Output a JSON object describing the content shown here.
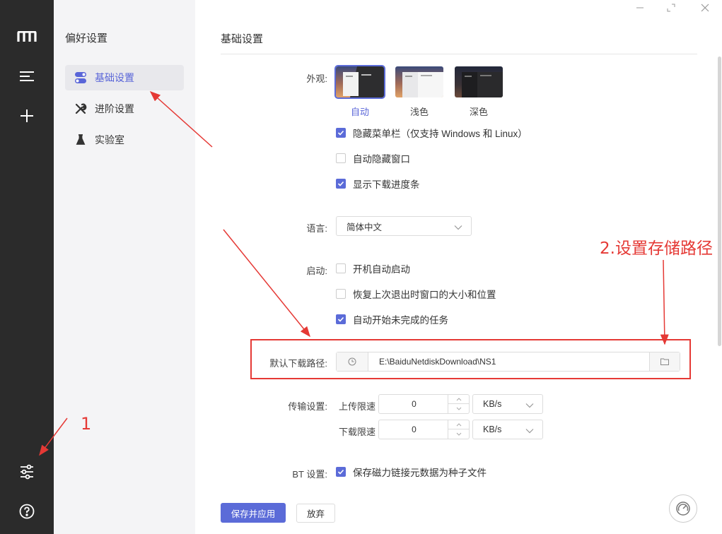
{
  "sidebar": {
    "title": "偏好设置",
    "items": [
      {
        "label": "基础设置"
      },
      {
        "label": "进阶设置"
      },
      {
        "label": "实验室"
      }
    ]
  },
  "main": {
    "title": "基础设置",
    "appearance": {
      "label": "外观:",
      "themes": [
        {
          "label": "自动",
          "selected": true
        },
        {
          "label": "浅色",
          "selected": false
        },
        {
          "label": "深色",
          "selected": false
        }
      ],
      "options": [
        {
          "label": "隐藏菜单栏（仅支持 Windows 和 Linux）",
          "checked": true
        },
        {
          "label": "自动隐藏窗口",
          "checked": false
        },
        {
          "label": "显示下载进度条",
          "checked": true
        }
      ]
    },
    "language": {
      "label": "语言:",
      "value": "简体中文"
    },
    "startup": {
      "label": "启动:",
      "options": [
        {
          "label": "开机自动启动",
          "checked": false
        },
        {
          "label": "恢复上次退出时窗口的大小和位置",
          "checked": false
        },
        {
          "label": "自动开始未完成的任务",
          "checked": true
        }
      ]
    },
    "download_path": {
      "label": "默认下载路径:",
      "value": "E:\\BaiduNetdiskDownload\\NS1"
    },
    "transfer": {
      "label": "传输设置:",
      "upload": {
        "label": "上传限速",
        "value": "0",
        "unit": "KB/s"
      },
      "download": {
        "label": "下载限速",
        "value": "0",
        "unit": "KB/s"
      }
    },
    "bt": {
      "label": "BT 设置:",
      "option": {
        "label": "保存磁力链接元数据为种子文件",
        "checked": true
      }
    },
    "buttons": {
      "save": "保存并应用",
      "discard": "放弃"
    }
  },
  "annotations": {
    "step1": "1",
    "step2": "2.设置存储路径"
  },
  "colors": {
    "accent": "#5b6bd8",
    "annotation": "#e53935",
    "rail": "#2b2b2b"
  }
}
